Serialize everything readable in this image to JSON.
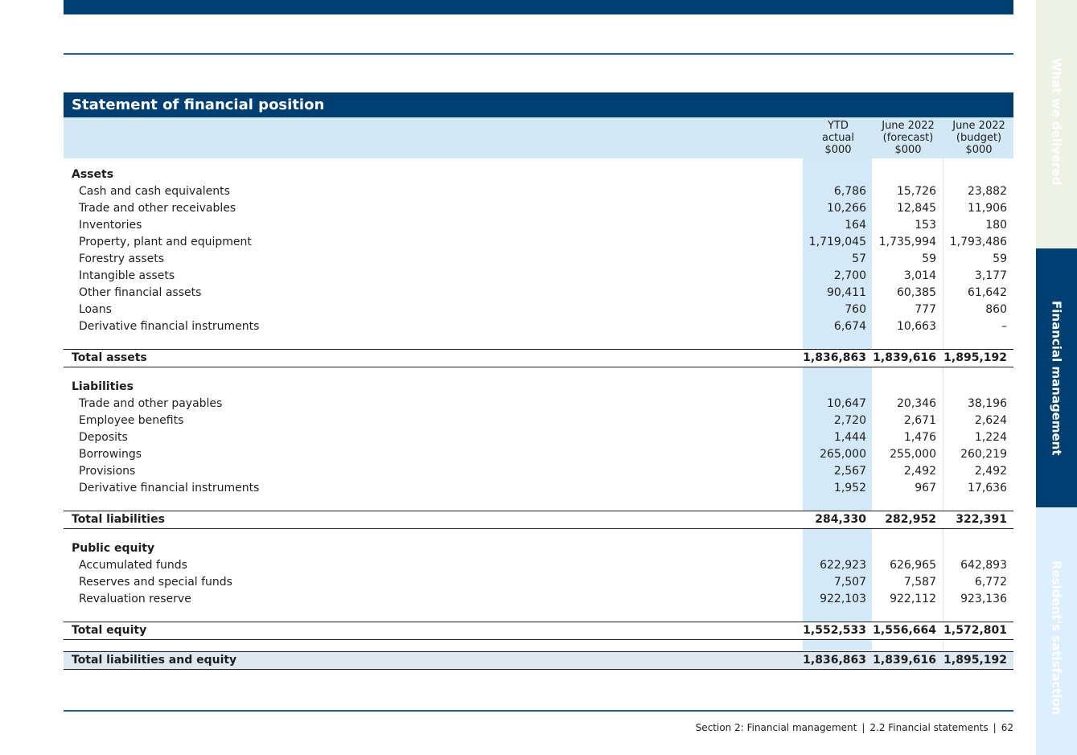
{
  "side_tabs": [
    "What we delivered",
    "Financial management",
    "Resident's satisfaction"
  ],
  "statement": {
    "title": "Statement of financial position",
    "columns": [
      [
        "YTD",
        "actual",
        "$000"
      ],
      [
        "June 2022",
        "(forecast)",
        "$000"
      ],
      [
        "June 2022",
        "(budget)",
        "$000"
      ]
    ],
    "assets": {
      "heading": "Assets",
      "rows": [
        {
          "label": "Cash and cash equivalents",
          "v": [
            "6,786",
            "15,726",
            "23,882"
          ]
        },
        {
          "label": "Trade and other receivables",
          "v": [
            "10,266",
            "12,845",
            "11,906"
          ]
        },
        {
          "label": "Inventories",
          "v": [
            "164",
            "153",
            "180"
          ]
        },
        {
          "label": "Property, plant and equipment",
          "v": [
            "1,719,045",
            "1,735,994",
            "1,793,486"
          ]
        },
        {
          "label": "Forestry assets",
          "v": [
            "57",
            "59",
            "59"
          ]
        },
        {
          "label": "Intangible assets",
          "v": [
            "2,700",
            "3,014",
            "3,177"
          ]
        },
        {
          "label": "Other financial assets",
          "v": [
            "90,411",
            "60,385",
            "61,642"
          ]
        },
        {
          "label": "Loans",
          "v": [
            "760",
            "777",
            "860"
          ]
        },
        {
          "label": "Derivative financial instruments",
          "v": [
            "6,674",
            "10,663",
            "–"
          ]
        }
      ],
      "total": {
        "label": "Total assets",
        "v": [
          "1,836,863",
          "1,839,616",
          "1,895,192"
        ]
      }
    },
    "liabilities": {
      "heading": "Liabilities",
      "rows": [
        {
          "label": "Trade and other payables",
          "v": [
            "10,647",
            "20,346",
            "38,196"
          ]
        },
        {
          "label": "Employee benefits",
          "v": [
            "2,720",
            "2,671",
            "2,624"
          ]
        },
        {
          "label": "Deposits",
          "v": [
            "1,444",
            "1,476",
            "1,224"
          ]
        },
        {
          "label": "Borrowings",
          "v": [
            "265,000",
            "255,000",
            "260,219"
          ]
        },
        {
          "label": "Provisions",
          "v": [
            "2,567",
            "2,492",
            "2,492"
          ]
        },
        {
          "label": "Derivative financial instruments",
          "v": [
            "1,952",
            "967",
            "17,636"
          ]
        }
      ],
      "total": {
        "label": "Total liabilities",
        "v": [
          "284,330",
          "282,952",
          "322,391"
        ]
      }
    },
    "equity": {
      "heading": "Public equity",
      "rows": [
        {
          "label": "Accumulated funds",
          "v": [
            "622,923",
            "626,965",
            "642,893"
          ]
        },
        {
          "label": "Reserves and special funds",
          "v": [
            "7,507",
            "7,587",
            "6,772"
          ]
        },
        {
          "label": "Revaluation reserve",
          "v": [
            "922,103",
            "922,112",
            "923,136"
          ]
        }
      ],
      "total": {
        "label": "Total equity",
        "v": [
          "1,552,533",
          "1,556,664",
          "1,572,801"
        ]
      }
    },
    "grand_total": {
      "label": "Total liabilities and equity",
      "v": [
        "1,836,863",
        "1,839,616",
        "1,895,192"
      ]
    }
  },
  "footer": {
    "section": "Section 2: Financial management",
    "subsection": "2.2 Financial statements",
    "page": "62",
    "separator": "|"
  }
}
